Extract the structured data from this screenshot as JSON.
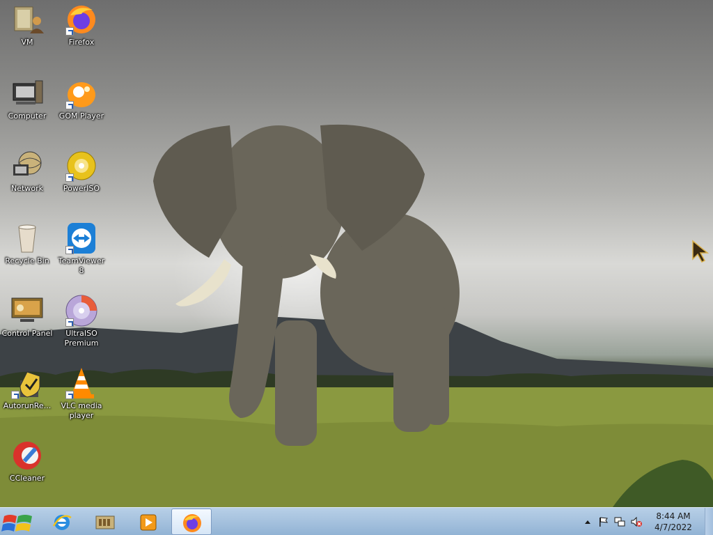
{
  "desktop": {
    "icons": [
      {
        "label": "VM",
        "icon": "vm-folder-icon"
      },
      {
        "label": "Firefox",
        "icon": "firefox-icon"
      },
      {
        "label": "Computer",
        "icon": "computer-icon"
      },
      {
        "label": "GOM Player",
        "icon": "gom-player-icon"
      },
      {
        "label": "Network",
        "icon": "network-icon"
      },
      {
        "label": "PowerISO",
        "icon": "poweriso-icon"
      },
      {
        "label": "Recycle Bin",
        "icon": "recycle-bin-icon"
      },
      {
        "label": "TeamViewer 8",
        "icon": "teamviewer-icon"
      },
      {
        "label": "Control Panel",
        "icon": "control-panel-icon"
      },
      {
        "label": "UltraISO Premium",
        "icon": "ultraiso-icon"
      },
      {
        "label": "AutorunRe...",
        "icon": "autorun-remover-icon"
      },
      {
        "label": "VLC media player",
        "icon": "vlc-icon"
      },
      {
        "label": "CCleaner",
        "icon": "ccleaner-icon"
      }
    ],
    "wallpaper": "elephant-wallpaper"
  },
  "taskbar": {
    "start_icon": "windows-start-icon",
    "pinned": [
      {
        "name": "internet-explorer",
        "icon": "internet-explorer-icon"
      },
      {
        "name": "file-explorer",
        "icon": "libraries-icon"
      },
      {
        "name": "media-player",
        "icon": "media-player-icon"
      },
      {
        "name": "firefox",
        "icon": "firefox-icon",
        "active": true
      }
    ],
    "tray": {
      "icons": [
        "show-hidden-icons-arrow",
        "action-center-flag-icon",
        "network-icon",
        "volume-muted-icon"
      ],
      "time": "8:44 AM",
      "date": "4/7/2022"
    }
  },
  "colors": {
    "taskbar": "#a9c4e0",
    "label_text": "#ffffff",
    "accent_blue": "#2a5db0"
  }
}
